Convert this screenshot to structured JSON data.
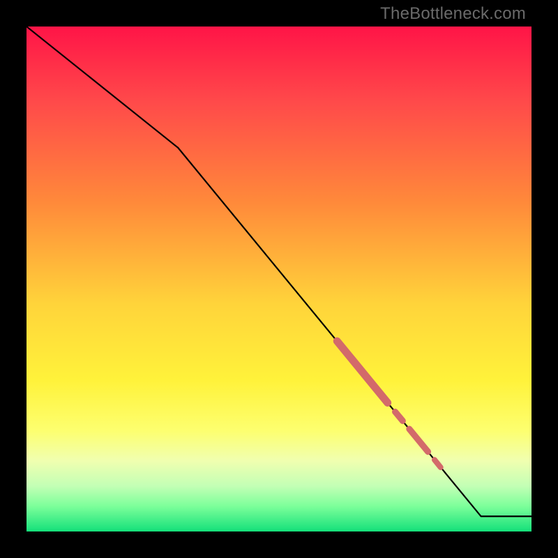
{
  "watermark": "TheBottleneck.com",
  "chart_data": {
    "type": "line",
    "title": "",
    "xlabel": "",
    "ylabel": "",
    "xlim": [
      0,
      100
    ],
    "ylim": [
      0,
      100
    ],
    "grid": false,
    "legend": false,
    "background_gradient": {
      "stops": [
        {
          "pct": 0,
          "color": "#ff1447"
        },
        {
          "pct": 15,
          "color": "#ff4a4a"
        },
        {
          "pct": 35,
          "color": "#ff8a3a"
        },
        {
          "pct": 55,
          "color": "#ffd43a"
        },
        {
          "pct": 70,
          "color": "#fff23a"
        },
        {
          "pct": 80,
          "color": "#fdff6f"
        },
        {
          "pct": 86,
          "color": "#f0ffb0"
        },
        {
          "pct": 91,
          "color": "#c3ffb5"
        },
        {
          "pct": 95,
          "color": "#7cff9a"
        },
        {
          "pct": 100,
          "color": "#14e07a"
        }
      ]
    },
    "curve": {
      "color": "#000000",
      "points_pct": [
        {
          "x": 0,
          "y": 100
        },
        {
          "x": 30,
          "y": 76
        },
        {
          "x": 90,
          "y": 3
        },
        {
          "x": 100,
          "y": 3
        }
      ]
    },
    "highlight_segments": {
      "color": "#d36a6a",
      "segments_pct": [
        {
          "x0": 61.5,
          "y0": 37.7,
          "x1": 71.5,
          "y1": 25.5,
          "w": 11
        },
        {
          "x0": 73.0,
          "y0": 23.7,
          "x1": 74.5,
          "y1": 21.9,
          "w": 9
        },
        {
          "x0": 75.8,
          "y0": 20.3,
          "x1": 79.5,
          "y1": 15.8,
          "w": 9
        },
        {
          "x0": 80.8,
          "y0": 14.2,
          "x1": 82.0,
          "y1": 12.7,
          "w": 8
        }
      ]
    }
  }
}
